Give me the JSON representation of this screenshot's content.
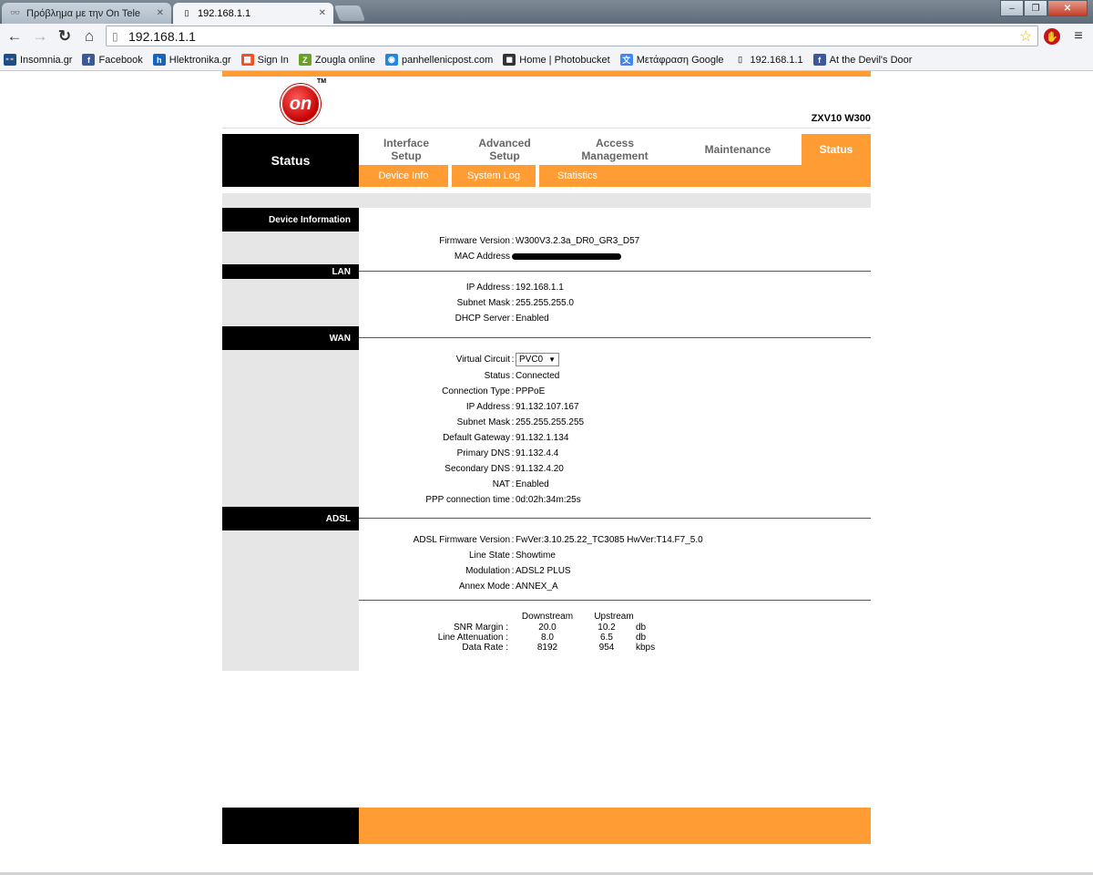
{
  "browser": {
    "tabs": [
      {
        "title": "Πρόβλημα με την On Tele",
        "icon": "glasses-icon"
      },
      {
        "title": "192.168.1.1",
        "icon": "page-icon"
      }
    ],
    "url": "192.168.1.1",
    "bookmarks": [
      {
        "label": "Insomnia.gr",
        "icon": "glasses-icon",
        "color": "#1a4f8c"
      },
      {
        "label": "Facebook",
        "icon": "facebook-icon",
        "color": "#3b5998"
      },
      {
        "label": "Hlektronika.gr",
        "icon": "h-icon",
        "color": "#1565c0"
      },
      {
        "label": "Sign In",
        "icon": "windows-icon",
        "color": "#f25022"
      },
      {
        "label": "Zougla online",
        "icon": "z-icon",
        "color": "#6aa121"
      },
      {
        "label": "panhellenicpost.com",
        "icon": "globe-icon",
        "color": "#1e88e5"
      },
      {
        "label": "Home | Photobucket",
        "icon": "camera-icon",
        "color": "#333333"
      },
      {
        "label": "Μετάφραση Google",
        "icon": "translate-icon",
        "color": "#4285f4"
      },
      {
        "label": "192.168.1.1",
        "icon": "page-icon",
        "color": "#888888"
      },
      {
        "label": "At the Devil's Door",
        "icon": "facebook-icon",
        "color": "#3b5998"
      }
    ]
  },
  "router": {
    "logo_text": "on",
    "logo_tm": "TM",
    "model": "ZXV10 W300",
    "section_title": "Status",
    "menu": [
      {
        "label": "Interface\nSetup",
        "active": false
      },
      {
        "label": "Advanced\nSetup",
        "active": false
      },
      {
        "label": "Access\nManagement",
        "active": false
      },
      {
        "label": "Maintenance",
        "active": false
      },
      {
        "label": "Status",
        "active": true
      }
    ],
    "submenu": [
      "Device Info",
      "System Log",
      "Statistics"
    ],
    "sections": {
      "device": {
        "title": "Device Information",
        "firmware_label": "Firmware Version",
        "firmware": "W300V3.2.3a_DR0_GR3_D57",
        "mac_label": "MAC Address"
      },
      "lan": {
        "title": "LAN",
        "rows": [
          {
            "label": "IP Address",
            "value": "192.168.1.1"
          },
          {
            "label": "Subnet Mask",
            "value": "255.255.255.0"
          },
          {
            "label": "DHCP Server",
            "value": "Enabled"
          }
        ]
      },
      "wan": {
        "title": "WAN",
        "vc_label": "Virtual Circuit",
        "vc_value": "PVC0",
        "rows": [
          {
            "label": "Status",
            "value": "Connected"
          },
          {
            "label": "Connection Type",
            "value": "PPPoE"
          },
          {
            "label": "IP Address",
            "value": "91.132.107.167"
          },
          {
            "label": "Subnet Mask",
            "value": "255.255.255.255"
          },
          {
            "label": "Default Gateway",
            "value": "91.132.1.134"
          },
          {
            "label": "Primary DNS",
            "value": "91.132.4.4"
          },
          {
            "label": "Secondary DNS",
            "value": "91.132.4.20"
          },
          {
            "label": "NAT",
            "value": "Enabled"
          },
          {
            "label": "PPP connection time",
            "value": "0d:02h:34m:25s"
          }
        ]
      },
      "adsl": {
        "title": "ADSL",
        "rows": [
          {
            "label": "ADSL Firmware Version",
            "value": "FwVer:3.10.25.22_TC3085 HwVer:T14.F7_5.0"
          },
          {
            "label": "Line State",
            "value": "Showtime"
          },
          {
            "label": "Modulation",
            "value": "ADSL2 PLUS"
          },
          {
            "label": "Annex Mode",
            "value": "ANNEX_A"
          }
        ],
        "stats_header": {
          "down": "Downstream",
          "up": "Upstream"
        },
        "stats": [
          {
            "label": "SNR Margin :",
            "down": "20.0",
            "up": "10.2",
            "unit": "db"
          },
          {
            "label": "Line Attenuation :",
            "down": "8.0",
            "up": "6.5",
            "unit": "db"
          },
          {
            "label": "Data Rate :",
            "down": "8192",
            "up": "954",
            "unit": "kbps"
          }
        ]
      }
    }
  }
}
